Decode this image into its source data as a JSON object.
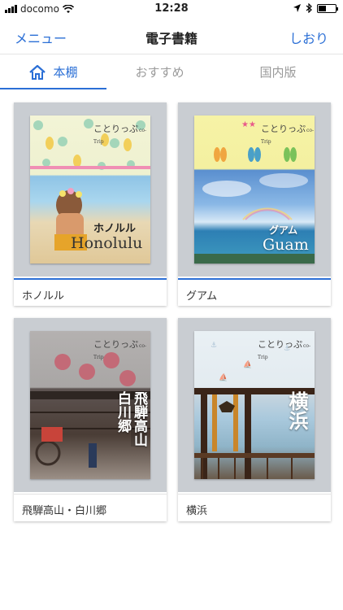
{
  "status_bar": {
    "carrier": "docomo",
    "time": "12:28"
  },
  "nav": {
    "left_label": "メニュー",
    "title": "電子書籍",
    "right_label": "しおり"
  },
  "tabs": [
    {
      "label": "本棚",
      "active": true
    },
    {
      "label": "おすすめ",
      "active": false
    },
    {
      "label": "国内版",
      "active": false
    }
  ],
  "books": [
    {
      "name": "ホノルル",
      "brand": "ことりっぷ",
      "brand_sub": "co-Trip",
      "cover_title_ja": "ホノルル",
      "cover_title_en": "Honolulu"
    },
    {
      "name": "グアム",
      "brand": "ことりっぷ",
      "brand_sub": "co-Trip",
      "cover_title_ja": "グアム",
      "cover_title_en": "Guam"
    },
    {
      "name": "飛騨高山・白川郷",
      "brand": "ことりっぷ",
      "brand_sub": "co-Trip",
      "cover_title_ja_line1": "飛騨高山",
      "cover_title_ja_line2": "白川郷"
    },
    {
      "name": "横浜",
      "brand": "ことりっぷ",
      "brand_sub": "co-Trip",
      "cover_title_ja": "横浜"
    }
  ],
  "colors": {
    "accent": "#2b6fd6",
    "inactive_tab": "#9a9a9a",
    "cover_frame": "#c9cdd2"
  }
}
